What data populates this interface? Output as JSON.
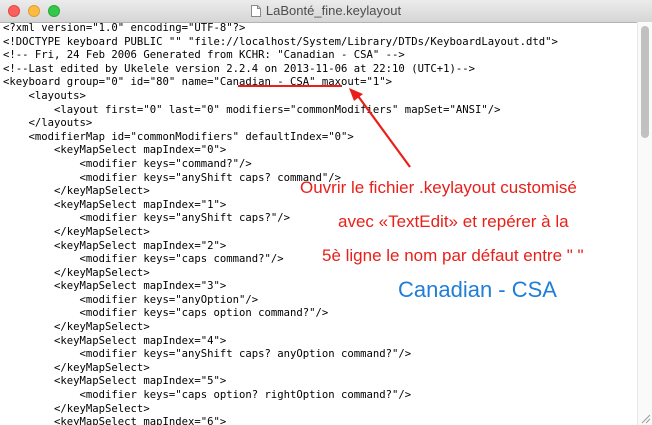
{
  "window": {
    "title": "LaBonté_fine.keylayout",
    "icon": "keylayout-document-icon"
  },
  "document": {
    "lines": [
      "<?xml version=\"1.0\" encoding=\"UTF-8\"?>",
      "<!DOCTYPE keyboard PUBLIC \"\" \"file://localhost/System/Library/DTDs/KeyboardLayout.dtd\">",
      "<!-- Fri, 24 Feb 2006 Generated from KCHR: \"Canadian - CSA\" -->",
      "<!--Last edited by Ukelele version 2.2.4 on 2013-11-06 at 22:10 (UTC+1)-->",
      "<keyboard group=\"0\" id=\"80\" name=\"Canadian - CSA\" maxout=\"1\">",
      "    <layouts>",
      "        <layout first=\"0\" last=\"0\" modifiers=\"commonModifiers\" mapSet=\"ANSI\"/>",
      "    </layouts>",
      "    <modifierMap id=\"commonModifiers\" defaultIndex=\"0\">",
      "        <keyMapSelect mapIndex=\"0\">",
      "            <modifier keys=\"command?\"/>",
      "            <modifier keys=\"anyShift caps? command\"/>",
      "        </keyMapSelect>",
      "        <keyMapSelect mapIndex=\"1\">",
      "            <modifier keys=\"anyShift caps?\"/>",
      "        </keyMapSelect>",
      "        <keyMapSelect mapIndex=\"2\">",
      "            <modifier keys=\"caps command?\"/>",
      "        </keyMapSelect>",
      "        <keyMapSelect mapIndex=\"3\">",
      "            <modifier keys=\"anyOption\"/>",
      "            <modifier keys=\"caps option command?\"/>",
      "        </keyMapSelect>",
      "        <keyMapSelect mapIndex=\"4\">",
      "            <modifier keys=\"anyShift caps? anyOption command?\"/>",
      "        </keyMapSelect>",
      "        <keyMapSelect mapIndex=\"5\">",
      "            <modifier keys=\"caps option? rightOption command?\"/>",
      "        </keyMapSelect>",
      "        <keyMapSelect mapIndex=\"6\">"
    ]
  },
  "annotation": {
    "line1": "Ouvrir le fichier .keylayout customisé",
    "line2": "avec «TextEdit» et repérer à la",
    "line3": "5è ligne le nom par défaut entre \" \"",
    "highlight": "Canadian - CSA"
  },
  "colors": {
    "annotation_red": "#e8201a",
    "annotation_blue": "#1e7ed8"
  }
}
